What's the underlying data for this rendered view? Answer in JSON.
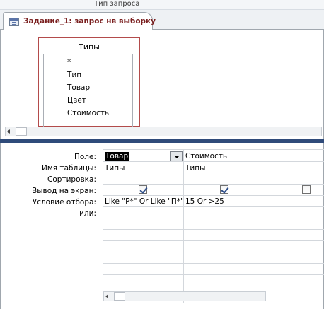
{
  "ribbon": {
    "group_label": "Тип запроса"
  },
  "document_tab": {
    "title": "Задание_1: запрос нв выборку"
  },
  "table": {
    "title": "Типы",
    "fields": [
      "*",
      "Тип",
      "Товар",
      "Цвет",
      "Стоимость"
    ]
  },
  "grid": {
    "row_labels": [
      "Поле:",
      "Имя таблицы:",
      "Сортировка:",
      "Вывод на экран:",
      "Условие отбора:",
      "или:"
    ],
    "columns": [
      {
        "field": "Товар",
        "table": "Типы",
        "sort": "",
        "show": true,
        "criteria": "Like \"Р*\" Or Like \"П*\"",
        "or": ""
      },
      {
        "field": "Стоимость",
        "table": "Типы",
        "sort": "",
        "show": true,
        "criteria": "15 Or >25",
        "or": ""
      },
      {
        "field": "",
        "table": "",
        "sort": "",
        "show": false,
        "criteria": "",
        "or": ""
      }
    ]
  },
  "icons": {
    "tab": "query-icon",
    "dropdown": "chevron-down-icon",
    "scroll_left": "scroll-left-arrow-icon"
  },
  "colors": {
    "splitter": "#2f4b7a",
    "table_border": "#b34b4b",
    "tab_title": "#7a1f1f"
  }
}
